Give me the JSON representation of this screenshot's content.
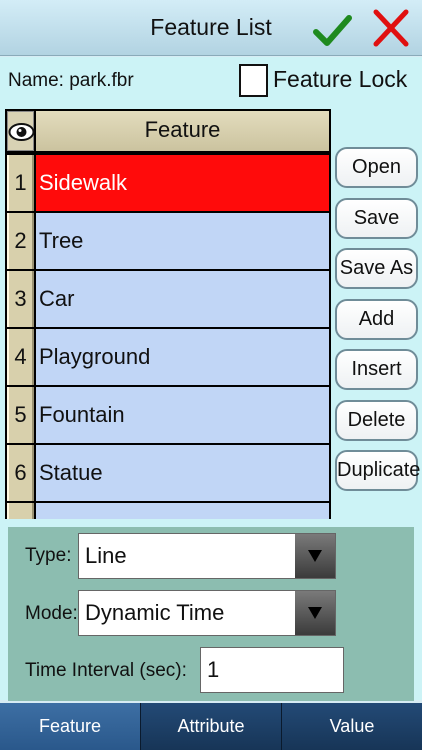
{
  "header": {
    "title": "Feature List",
    "confirm_icon": "checkmark-icon",
    "cancel_icon": "close-icon"
  },
  "file": {
    "name_label": "Name: park.fbr"
  },
  "lock": {
    "label": "Feature Lock",
    "checked": false
  },
  "table": {
    "visibility_icon": "eye-icon",
    "column_header": "Feature",
    "rows": [
      {
        "num": "1",
        "name": "Sidewalk",
        "selected": true
      },
      {
        "num": "2",
        "name": "Tree"
      },
      {
        "num": "3",
        "name": "Car"
      },
      {
        "num": "4",
        "name": "Playground"
      },
      {
        "num": "5",
        "name": "Fountain"
      },
      {
        "num": "6",
        "name": "Statue"
      }
    ]
  },
  "actions": {
    "open": "Open",
    "save": "Save",
    "save_as": "Save As",
    "add": "Add",
    "insert": "Insert",
    "delete": "Delete",
    "duplicate": "Duplicate"
  },
  "settings": {
    "type_label": "Type:",
    "type_value": "Line",
    "mode_label": "Mode:",
    "mode_value": "Dynamic Time",
    "interval_label": "Time Interval (sec):",
    "interval_value": "1"
  },
  "tabs": {
    "feature": "Feature",
    "attribute": "Attribute",
    "value": "Value",
    "active": "feature"
  },
  "colors": {
    "selected_row": "#ff0b0b",
    "row_bg": "#c1d6f6",
    "confirm": "#1f8a1f",
    "cancel": "#e01010"
  }
}
